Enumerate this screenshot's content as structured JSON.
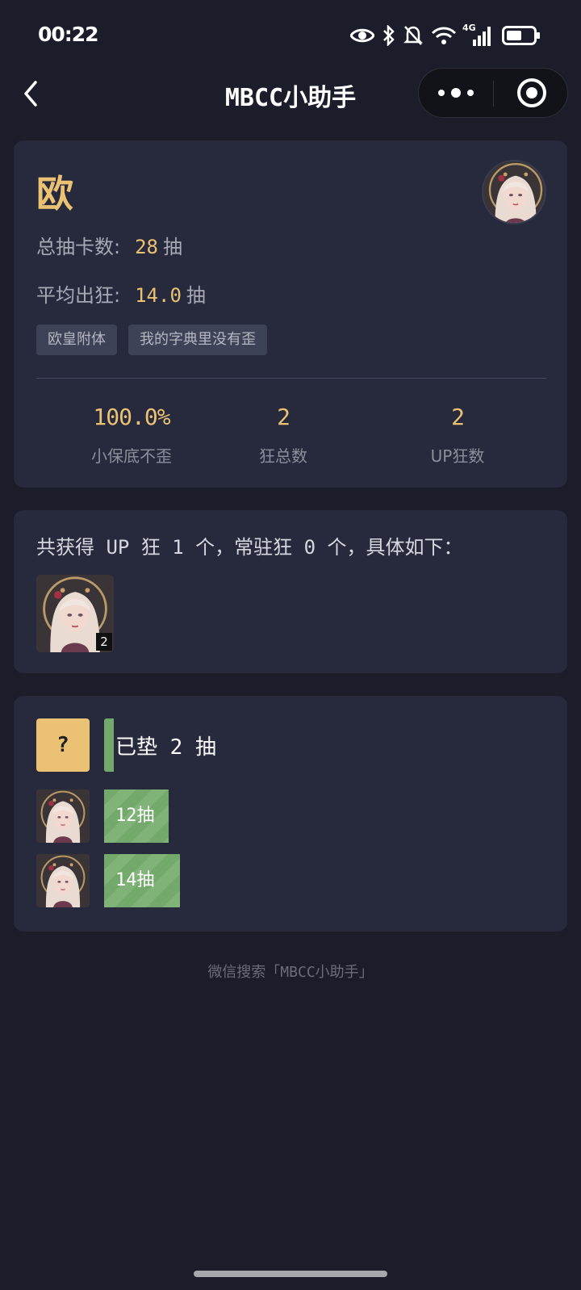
{
  "status_bar": {
    "time": "00:22",
    "network_label": "4G",
    "icons": [
      "eye-icon",
      "bluetooth-icon",
      "bell-muted-icon",
      "wifi-icon",
      "signal-icon",
      "battery-icon"
    ]
  },
  "nav": {
    "title": "MBCC小助手",
    "back_icon": "chevron-left-icon",
    "more_icon": "more-dots-icon",
    "close_icon": "target-icon"
  },
  "summary_card": {
    "rank": "欧",
    "total_label": "总抽卡数:",
    "total_value": "28",
    "total_unit": "抽",
    "avg_label": "平均出狂:",
    "avg_value": "14.0",
    "avg_unit": "抽",
    "tags": [
      "欧皇附体",
      "我的字典里没有歪"
    ],
    "kpis": [
      {
        "value": "100.0%",
        "label": "小保底不歪"
      },
      {
        "value": "2",
        "label": "狂总数"
      },
      {
        "value": "2",
        "label": "UP狂数"
      }
    ]
  },
  "obtained_card": {
    "summary": "共获得 UP 狂 1 个，常驻狂 0 个，具体如下：",
    "characters": [
      {
        "count": "2"
      }
    ]
  },
  "history_card": {
    "unknown_symbol": "?",
    "pity_text": "已垫 2 抽",
    "rows": [
      {
        "label": "12抽",
        "pulls": 12
      },
      {
        "label": "14抽",
        "pulls": 14
      }
    ]
  },
  "footer": "微信搜索「MBCC小助手」",
  "colors": {
    "background": "#1b1d2b",
    "card": "#262a3c",
    "accent": "#ebc274",
    "bar_green": "#73a96b"
  }
}
